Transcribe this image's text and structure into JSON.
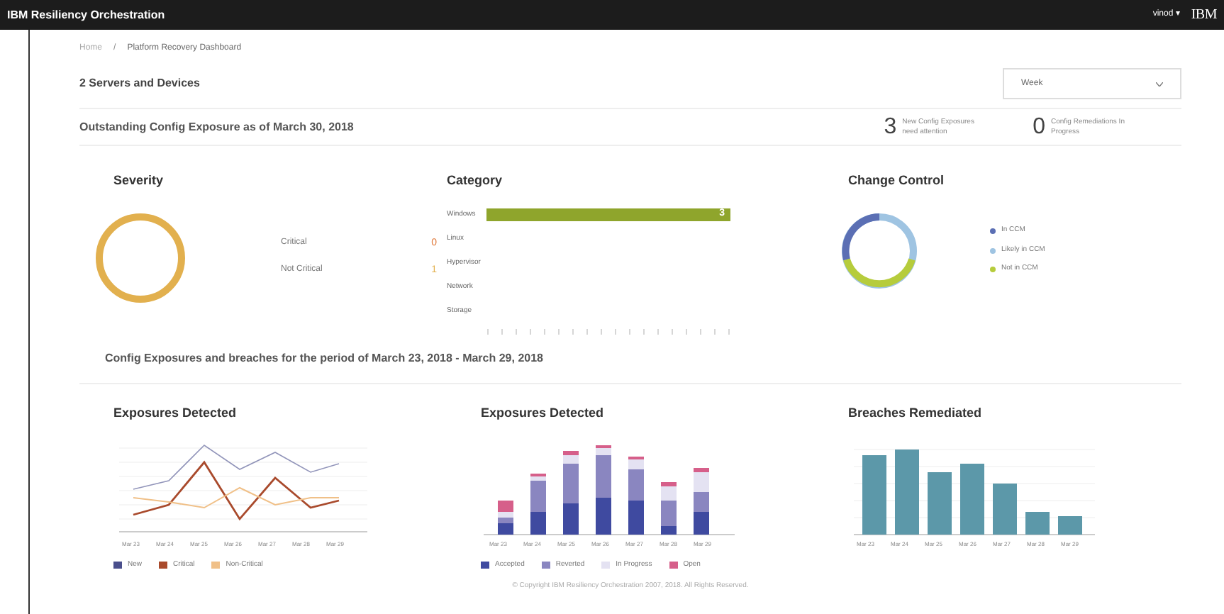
{
  "app_bar": {
    "title": "IBM Resiliency Orchestration",
    "user": "vinod",
    "user_caret": "▾",
    "logo": "IBM"
  },
  "breadcrumb": {
    "separator": "/",
    "items": [
      {
        "label": "Home"
      },
      {
        "label": "Platform Recovery Dashboard"
      }
    ]
  },
  "header": {
    "title": "2 Servers and Devices",
    "period_select": {
      "value": "Week"
    }
  },
  "outstanding": {
    "title": "Outstanding Config Exposure as of March 30, 2018",
    "stats": [
      {
        "value": "3",
        "label": "New Config Exposures need attention"
      },
      {
        "value": "0",
        "label": "Config Remediations In Progress"
      }
    ]
  },
  "severity": {
    "title": "Severity",
    "items": [
      {
        "label": "Critical",
        "count": "0",
        "color": "#e0793a"
      },
      {
        "label": "Not Critical",
        "count": "1",
        "color": "#e2b04e"
      }
    ]
  },
  "category": {
    "title": "Category",
    "chart_data": {
      "type": "bar",
      "orientation": "horizontal",
      "categories": [
        "Windows",
        "Linux",
        "Hypervisor",
        "Network",
        "Storage"
      ],
      "values": [
        3,
        0,
        0,
        0,
        0
      ],
      "value_labels": [
        "3",
        null,
        null,
        null,
        null
      ]
    }
  },
  "change_control": {
    "title": "Change Control",
    "items": [
      {
        "label": "In CCM",
        "color": "#5b6fb4"
      },
      {
        "label": "Likely in CCM",
        "color": "#9fc4e2"
      },
      {
        "label": "Not in CCM",
        "color": "#b6cc3c"
      }
    ]
  },
  "period": {
    "title": "Config Exposures and breaches for the period of March 23, 2018 - March 29, 2018"
  },
  "panels": [
    {
      "kind": "line",
      "title": "Exposures Detected",
      "x_labels": [
        "Mar 23",
        "Mar 24",
        "Mar 25",
        "Mar 26",
        "Mar 27",
        "Mar 28",
        "Mar 29"
      ],
      "legend": [
        {
          "label": "New",
          "color": "#4a4f8c"
        },
        {
          "label": "Critical",
          "color": "#a94a2c"
        },
        {
          "label": "Non-Critical",
          "color": "#f0c088"
        }
      ]
    },
    {
      "kind": "stacked",
      "title": "Exposures Detected",
      "x_labels": [
        "Mar 23",
        "Mar 24",
        "Mar 25",
        "Mar 26",
        "Mar 27",
        "Mar 28",
        "Mar 29"
      ],
      "legend": [
        {
          "label": "Accepted",
          "color": "#3f4aa0"
        },
        {
          "label": "Reverted",
          "color": "#8a86c0"
        },
        {
          "label": "In Progress",
          "color": "#e4e2f2"
        },
        {
          "label": "Open",
          "color": "#d65f8a"
        }
      ]
    },
    {
      "kind": "bar",
      "title": "Breaches Remediated",
      "x_labels": [
        "Mar 23",
        "Mar 24",
        "Mar 25",
        "Mar 26",
        "Mar 27",
        "Mar 28",
        "Mar 29"
      ]
    }
  ],
  "footer": "© Copyright IBM Resiliency Orchestration 2007, 2018. All Rights Reserved."
}
